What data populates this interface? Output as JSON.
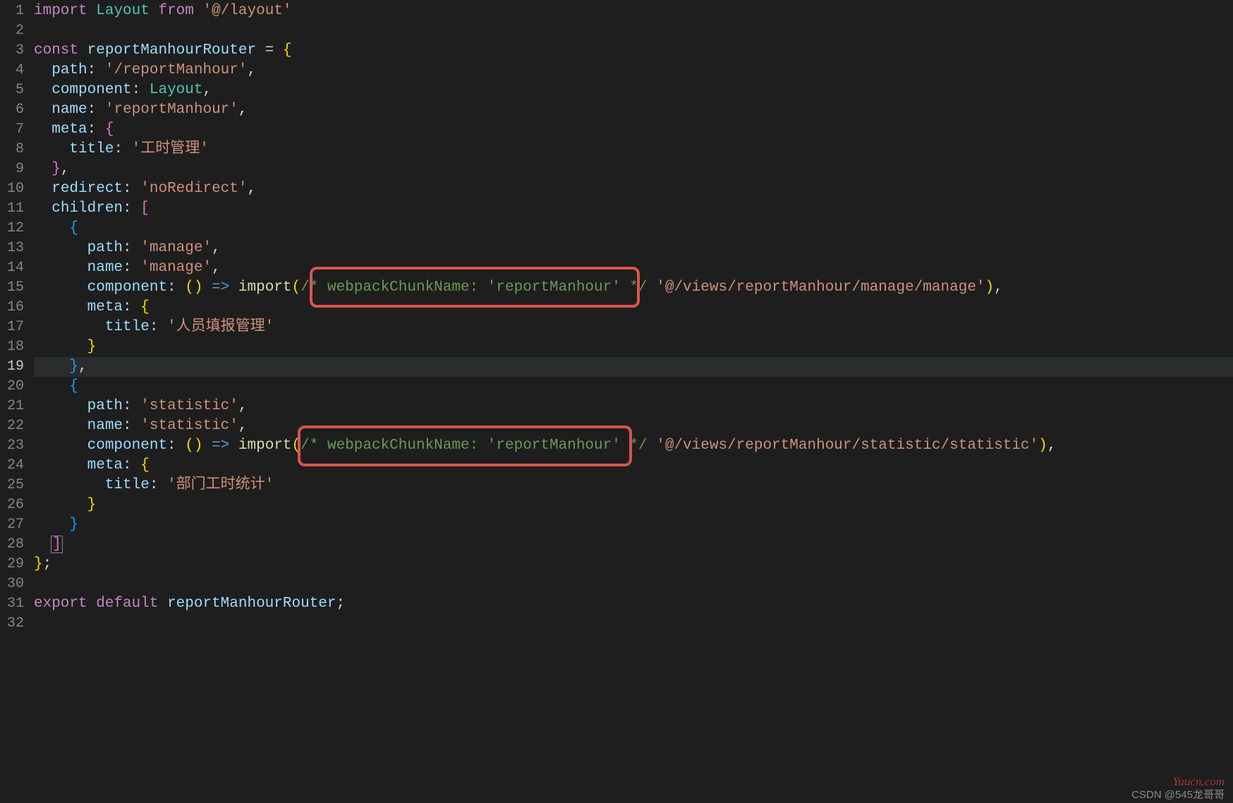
{
  "active_line": 19,
  "lines": {
    "l1": [
      [
        "keyword",
        "import"
      ],
      [
        "plain",
        " "
      ],
      [
        "type",
        "Layout"
      ],
      [
        "plain",
        " "
      ],
      [
        "keyword",
        "from"
      ],
      [
        "plain",
        " "
      ],
      [
        "string",
        "'@/layout'"
      ]
    ],
    "l2": [
      [
        "plain",
        ""
      ]
    ],
    "l3": [
      [
        "keyword",
        "const"
      ],
      [
        "plain",
        " "
      ],
      [
        "ident",
        "reportManhourRouter"
      ],
      [
        "plain",
        " = "
      ],
      [
        "brace",
        "{"
      ]
    ],
    "l4": [
      [
        "plain",
        "  "
      ],
      [
        "ident",
        "path"
      ],
      [
        "plain",
        ": "
      ],
      [
        "string",
        "'/reportManhour'"
      ],
      [
        "plain",
        ","
      ]
    ],
    "l5": [
      [
        "plain",
        "  "
      ],
      [
        "ident",
        "component"
      ],
      [
        "plain",
        ": "
      ],
      [
        "type",
        "Layout"
      ],
      [
        "plain",
        ","
      ]
    ],
    "l6": [
      [
        "plain",
        "  "
      ],
      [
        "ident",
        "name"
      ],
      [
        "plain",
        ": "
      ],
      [
        "string",
        "'reportManhour'"
      ],
      [
        "plain",
        ","
      ]
    ],
    "l7": [
      [
        "plain",
        "  "
      ],
      [
        "ident",
        "meta"
      ],
      [
        "plain",
        ": "
      ],
      [
        "brace2",
        "{"
      ]
    ],
    "l8": [
      [
        "plain",
        "    "
      ],
      [
        "ident",
        "title"
      ],
      [
        "plain",
        ": "
      ],
      [
        "string",
        "'工时管理'"
      ]
    ],
    "l9": [
      [
        "plain",
        "  "
      ],
      [
        "brace2",
        "}"
      ],
      [
        "plain",
        ","
      ]
    ],
    "l10": [
      [
        "plain",
        "  "
      ],
      [
        "ident",
        "redirect"
      ],
      [
        "plain",
        ": "
      ],
      [
        "string",
        "'noRedirect'"
      ],
      [
        "plain",
        ","
      ]
    ],
    "l11": [
      [
        "plain",
        "  "
      ],
      [
        "ident",
        "children"
      ],
      [
        "plain",
        ": "
      ],
      [
        "brace2",
        "["
      ]
    ],
    "l12": [
      [
        "plain",
        "    "
      ],
      [
        "brace3",
        "{"
      ]
    ],
    "l13": [
      [
        "plain",
        "      "
      ],
      [
        "ident",
        "path"
      ],
      [
        "plain",
        ": "
      ],
      [
        "string",
        "'manage'"
      ],
      [
        "plain",
        ","
      ]
    ],
    "l14": [
      [
        "plain",
        "      "
      ],
      [
        "ident",
        "name"
      ],
      [
        "plain",
        ": "
      ],
      [
        "string",
        "'manage'"
      ],
      [
        "plain",
        ","
      ]
    ],
    "l15": [
      [
        "plain",
        "      "
      ],
      [
        "ident",
        "component"
      ],
      [
        "plain",
        ": "
      ],
      [
        "brace",
        "("
      ],
      [
        "brace",
        ")"
      ],
      [
        "plain",
        " "
      ],
      [
        "arrow",
        "=>"
      ],
      [
        "plain",
        " "
      ],
      [
        "func",
        "import"
      ],
      [
        "brace",
        "("
      ],
      [
        "comment",
        "/* webpackChunkName: 'reportManhour' */"
      ],
      [
        "plain",
        " "
      ],
      [
        "string",
        "'@/views/reportManhour/manage/manage'"
      ],
      [
        "brace",
        ")"
      ],
      [
        "plain",
        ","
      ]
    ],
    "l16": [
      [
        "plain",
        "      "
      ],
      [
        "ident",
        "meta"
      ],
      [
        "plain",
        ": "
      ],
      [
        "brace",
        "{"
      ]
    ],
    "l17": [
      [
        "plain",
        "        "
      ],
      [
        "ident",
        "title"
      ],
      [
        "plain",
        ": "
      ],
      [
        "string",
        "'人员填报管理'"
      ]
    ],
    "l18": [
      [
        "plain",
        "      "
      ],
      [
        "brace",
        "}"
      ]
    ],
    "l19": [
      [
        "plain",
        "    "
      ],
      [
        "brace3",
        "}"
      ],
      [
        "plain",
        ","
      ]
    ],
    "l20": [
      [
        "plain",
        "    "
      ],
      [
        "brace3",
        "{"
      ]
    ],
    "l21": [
      [
        "plain",
        "      "
      ],
      [
        "ident",
        "path"
      ],
      [
        "plain",
        ": "
      ],
      [
        "string",
        "'statistic'"
      ],
      [
        "plain",
        ","
      ]
    ],
    "l22": [
      [
        "plain",
        "      "
      ],
      [
        "ident",
        "name"
      ],
      [
        "plain",
        ": "
      ],
      [
        "string",
        "'statistic'"
      ],
      [
        "plain",
        ","
      ]
    ],
    "l23": [
      [
        "plain",
        "      "
      ],
      [
        "ident",
        "component"
      ],
      [
        "plain",
        ": "
      ],
      [
        "brace",
        "("
      ],
      [
        "brace",
        ")"
      ],
      [
        "plain",
        " "
      ],
      [
        "arrow",
        "=>"
      ],
      [
        "plain",
        " "
      ],
      [
        "func",
        "import"
      ],
      [
        "brace",
        "("
      ],
      [
        "comment",
        "/* webpackChunkName: 'reportManhour' */"
      ],
      [
        "plain",
        " "
      ],
      [
        "string",
        "'@/views/reportManhour/statistic/statistic'"
      ],
      [
        "brace",
        ")"
      ],
      [
        "plain",
        ","
      ]
    ],
    "l24": [
      [
        "plain",
        "      "
      ],
      [
        "ident",
        "meta"
      ],
      [
        "plain",
        ": "
      ],
      [
        "brace",
        "{"
      ]
    ],
    "l25": [
      [
        "plain",
        "        "
      ],
      [
        "ident",
        "title"
      ],
      [
        "plain",
        ": "
      ],
      [
        "string",
        "'部门工时统计'"
      ]
    ],
    "l26": [
      [
        "plain",
        "      "
      ],
      [
        "brace",
        "}"
      ]
    ],
    "l27": [
      [
        "plain",
        "    "
      ],
      [
        "brace3",
        "}"
      ]
    ],
    "l28": [
      [
        "plain",
        "  "
      ],
      [
        "brace2m",
        "]"
      ]
    ],
    "l29": [
      [
        "brace",
        "}"
      ],
      [
        "plain",
        ";"
      ]
    ],
    "l30": [
      [
        "plain",
        ""
      ]
    ],
    "l31": [
      [
        "keyword",
        "export"
      ],
      [
        "plain",
        " "
      ],
      [
        "keyword",
        "default"
      ],
      [
        "plain",
        " "
      ],
      [
        "ident",
        "reportManhourRouter"
      ],
      [
        "plain",
        ";"
      ]
    ],
    "l32": [
      [
        "plain",
        ""
      ]
    ]
  },
  "watermarks": {
    "site": "Yuucn.com",
    "credit": "CSDN @545龙哥哥"
  }
}
